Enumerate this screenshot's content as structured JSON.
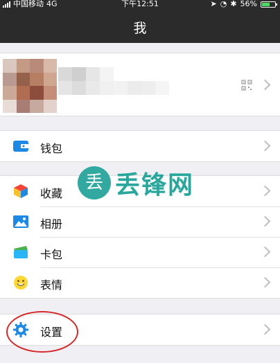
{
  "status_bar": {
    "carrier": "中国移动",
    "network": "4G",
    "time": "下午12:51",
    "battery": "56%",
    "battery_level": 0.56
  },
  "nav": {
    "title": "我"
  },
  "menu": {
    "wallet": "钱包",
    "favorites": "收藏",
    "album": "相册",
    "cards": "卡包",
    "stickers": "表情",
    "settings": "设置"
  },
  "watermark": {
    "glyph": "丢",
    "text": "丢锋网"
  },
  "colors": {
    "nav_bg": "#2b2b2b",
    "page_bg": "#efeff4",
    "accent_blue": "#1e88e5",
    "annotation_red": "#d42929"
  }
}
